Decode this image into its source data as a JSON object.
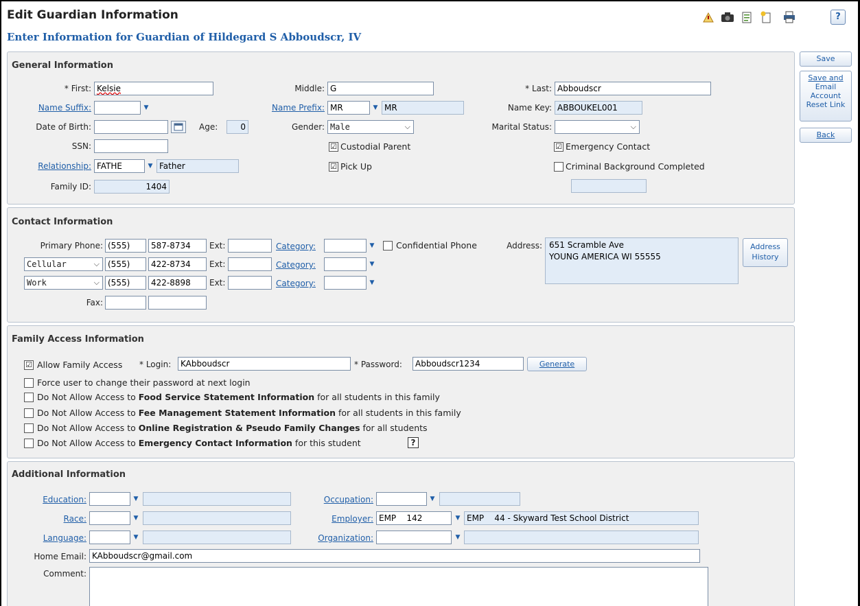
{
  "header": {
    "title": "Edit Guardian Information",
    "subtitle": "Enter Information for Guardian of Hildegard S Abboudscr, IV",
    "toolbar_icons": [
      "report-icon",
      "camera-icon",
      "notes-icon",
      "new-page-icon",
      "print-icon",
      "help-icon"
    ],
    "help_label": "?"
  },
  "side_buttons": {
    "save": "Save",
    "save_email_1": "Save and",
    "save_email_2": "Email",
    "save_email_3": "Account",
    "save_email_4": "Reset Link",
    "back": "Back"
  },
  "general": {
    "title": "General Information",
    "first_label": "* First:",
    "first": "Kelsie",
    "middle_label": "Middle:",
    "middle": "G",
    "last_label": "* Last:",
    "last": "Abboudscr",
    "suffix_label": "Name Suffix:",
    "suffix": "",
    "prefix_label": "Name Prefix:",
    "prefix_code": "MR",
    "prefix_desc": "MR",
    "namekey_label": "Name Key:",
    "namekey": "ABBOUKEL001",
    "dob_label": "Date of Birth:",
    "dob": "",
    "age_label": "Age:",
    "age": "0",
    "gender_label": "Gender:",
    "gender": "Male",
    "marital_label": "Marital Status:",
    "marital": "",
    "ssn_label": "SSN:",
    "ssn": "",
    "custodial_label": "Custodial Parent",
    "emergency_label": "Emergency Contact",
    "relationship_label": "Relationship:",
    "relationship_code": "FATHE",
    "relationship_desc": "Father",
    "pickup_label": "Pick Up",
    "criminal_label": "Criminal Background Completed",
    "familyid_label": "Family ID:",
    "familyid": "1404",
    "checked": "☑"
  },
  "contact": {
    "title": "Contact Information",
    "primary_label": "Primary Phone:",
    "phones": [
      {
        "type": "",
        "area": "(555)",
        "number": "587-8734"
      },
      {
        "type": "Cellular",
        "area": "(555)",
        "number": "422-8734"
      },
      {
        "type": "Work",
        "area": "(555)",
        "number": "422-8898"
      }
    ],
    "ext_label": "Ext:",
    "category_label": "Category:",
    "confidential_label": "Confidential Phone",
    "address_label": "Address:",
    "address_line1": "651 Scramble Ave",
    "address_line2": "YOUNG AMERICA WI 55555",
    "address_history_1": "Address",
    "address_history_2": "History",
    "fax_label": "Fax:"
  },
  "family": {
    "title": "Family Access Information",
    "allow_label": "Allow Family Access",
    "login_label": "* Login:",
    "login": "KAbboudscr",
    "password_label": "* Password:",
    "password": "Abboudscr1234",
    "generate": "Generate",
    "opt1": "Force user to change their password at next login",
    "opt2_pre": "Do Not Allow Access to ",
    "opt2_bold": "Food Service Statement Information",
    "opt2_post": " for all students in this family",
    "opt3_pre": "Do Not Allow Access to ",
    "opt3_bold": "Fee Management Statement Information",
    "opt3_post": " for all students in this family",
    "opt4_pre": "Do Not Allow Access to ",
    "opt4_bold": "Online Registration & Pseudo Family Changes",
    "opt4_post": " for all students",
    "opt5_pre": "Do Not Allow Access to ",
    "opt5_bold": "Emergency Contact Information",
    "opt5_post": " for this student",
    "help": "?"
  },
  "additional": {
    "title": "Additional Information",
    "education_label": "Education:",
    "occupation_label": "Occupation:",
    "race_label": "Race:",
    "employer_label": "Employer:",
    "employer_code": "EMP    142",
    "employer_desc": "EMP    44 - Skyward Test School District",
    "language_label": "Language:",
    "organization_label": "Organization:",
    "email_label": "Home Email:",
    "email": "KAbboudscr@gmail.com",
    "comment_label": "Comment:"
  },
  "colors": {
    "accent": "#1f5ea8",
    "panel": "#f0f0f0",
    "readonly": "#e2ecf7"
  }
}
